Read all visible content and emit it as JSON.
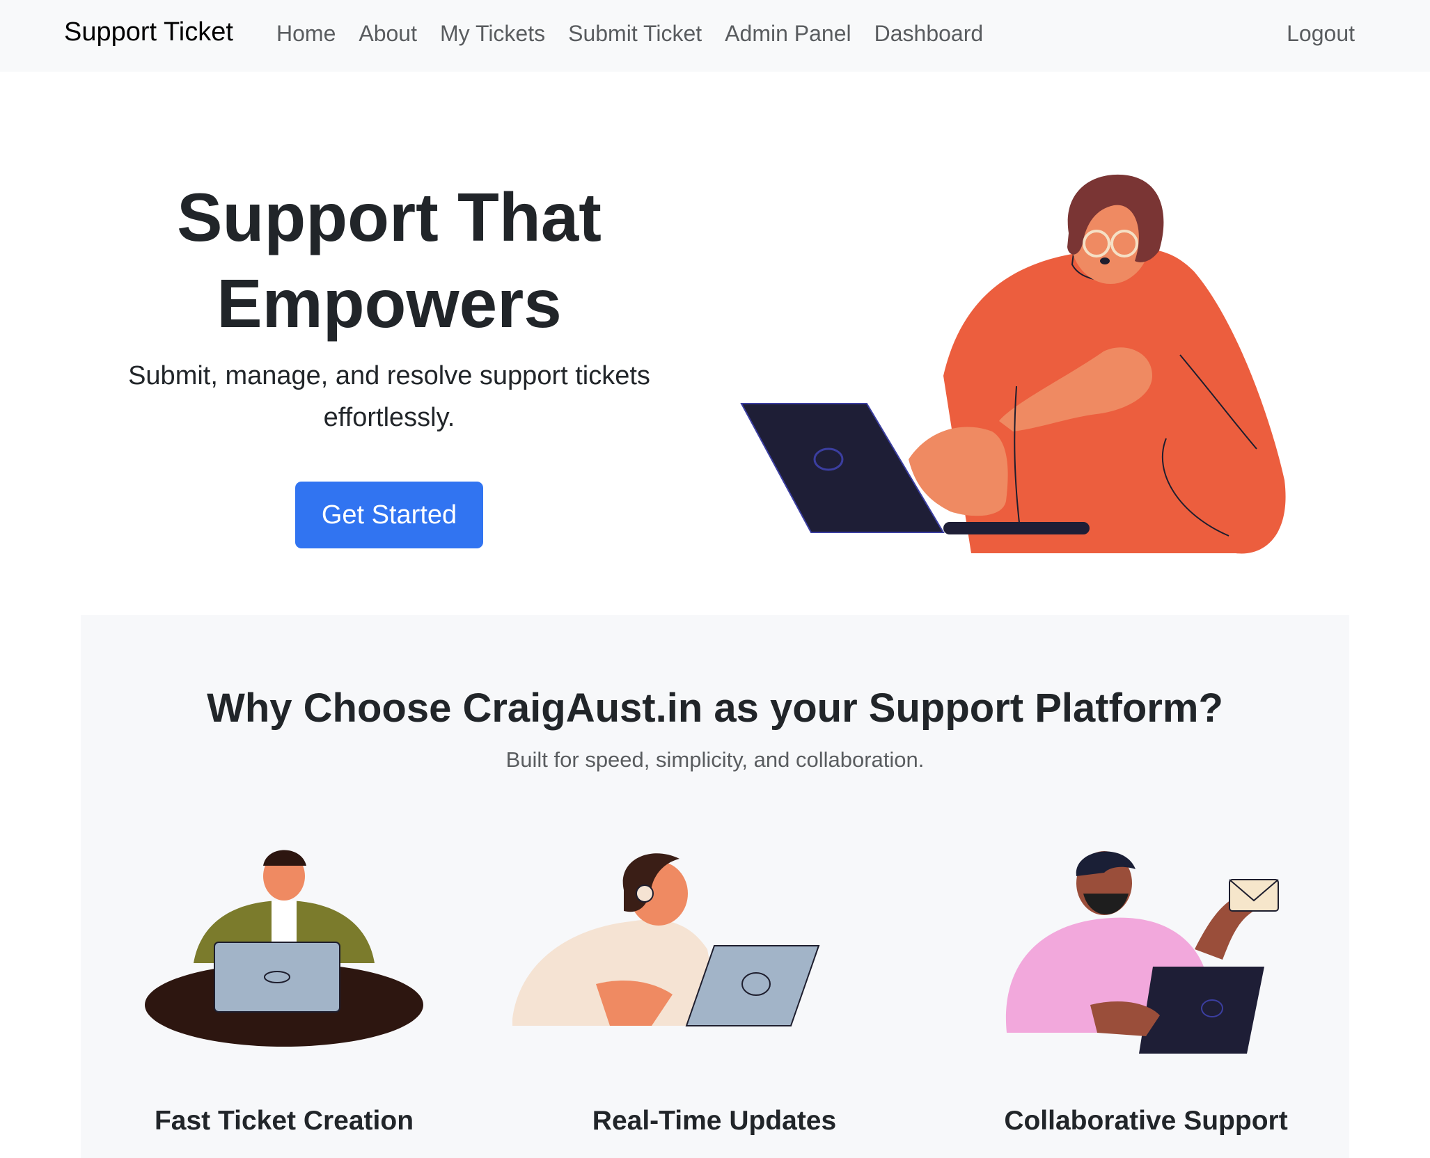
{
  "navbar": {
    "brand": "Support Ticket",
    "links": [
      "Home",
      "About",
      "My Tickets",
      "Submit Ticket",
      "Admin Panel",
      "Dashboard"
    ],
    "logout": "Logout"
  },
  "hero": {
    "title_line1": "Support That",
    "title_line2": "Empowers",
    "subtitle": "Submit, manage, and resolve support tickets effortlessly.",
    "cta": "Get Started"
  },
  "features": {
    "title": "Why Choose CraigAust.in as your Support Platform?",
    "subtitle": "Built for speed, simplicity, and collaboration.",
    "items": [
      {
        "title": "Fast Ticket Creation"
      },
      {
        "title": "Real-Time Updates"
      },
      {
        "title": "Collaborative Support"
      }
    ]
  },
  "colors": {
    "primary_button": "#3174f1",
    "navbar_bg": "#f8f9fa",
    "section_bg": "#f7f8fa",
    "sweater_orange": "#ec5e3e"
  }
}
